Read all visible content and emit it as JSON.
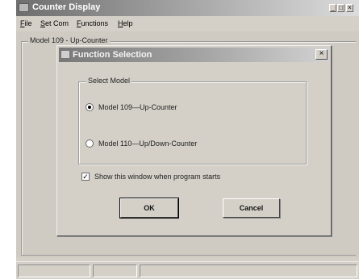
{
  "main_window": {
    "title": "Counter Display",
    "minimize_glyph": "_",
    "maximize_glyph": "□",
    "close_glyph": "×",
    "menu": [
      "File",
      "Set Com",
      "Functions",
      "Help"
    ],
    "current_model_label": "Model 109 - Up-Counter"
  },
  "dialog": {
    "title": "Function Selection",
    "close_glyph": "×",
    "group_label": "Select Model",
    "options": [
      {
        "label": "Model 109—Up-Counter",
        "selected": true
      },
      {
        "label": "Model 110—Up/Down-Counter",
        "selected": false
      }
    ],
    "checkbox_label": "Show this window when program starts",
    "checkbox_checked": true,
    "checkbox_glyph": "✓",
    "ok_label": "OK",
    "cancel_label": "Cancel"
  }
}
